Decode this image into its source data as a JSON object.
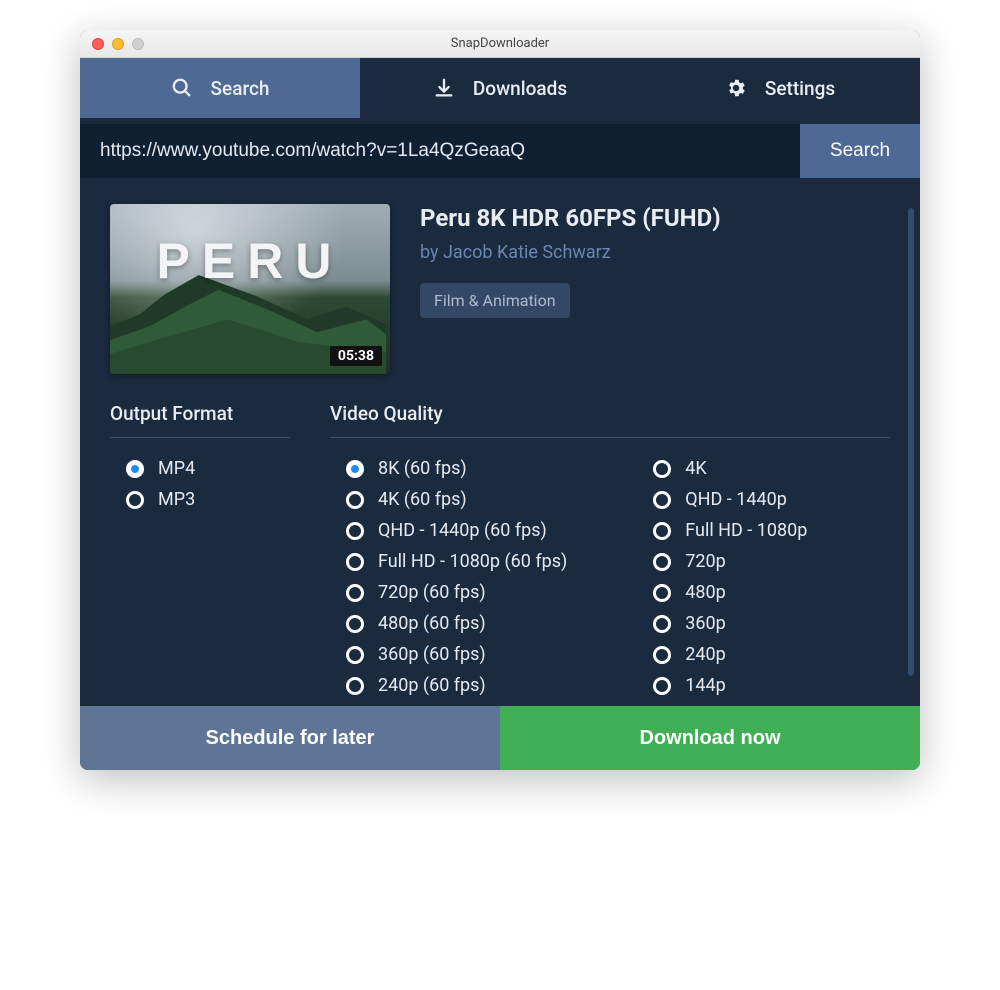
{
  "window": {
    "title": "SnapDownloader"
  },
  "tabs": {
    "search": "Search",
    "downloads": "Downloads",
    "settings": "Settings",
    "active": "search"
  },
  "search": {
    "value": "https://www.youtube.com/watch?v=1La4QzGeaaQ",
    "button": "Search"
  },
  "video": {
    "title": "Peru 8K HDR 60FPS (FUHD)",
    "author_prefix": "by ",
    "author": "Jacob Katie Schwarz",
    "tag": "Film & Animation",
    "duration": "05:38",
    "thumb_text": "PERU"
  },
  "format": {
    "heading": "Output Format",
    "options": [
      "MP4",
      "MP3"
    ],
    "selected": "MP4"
  },
  "quality": {
    "heading": "Video Quality",
    "col1": [
      "8K (60 fps)",
      "4K (60 fps)",
      "QHD - 1440p (60 fps)",
      "Full HD - 1080p (60 fps)",
      "720p (60 fps)",
      "480p (60 fps)",
      "360p (60 fps)",
      "240p (60 fps)"
    ],
    "col2": [
      "4K",
      "QHD - 1440p",
      "Full HD - 1080p",
      "720p",
      "480p",
      "360p",
      "240p",
      "144p"
    ],
    "selected": "8K (60 fps)"
  },
  "actions": {
    "schedule": "Schedule for later",
    "download": "Download now"
  }
}
